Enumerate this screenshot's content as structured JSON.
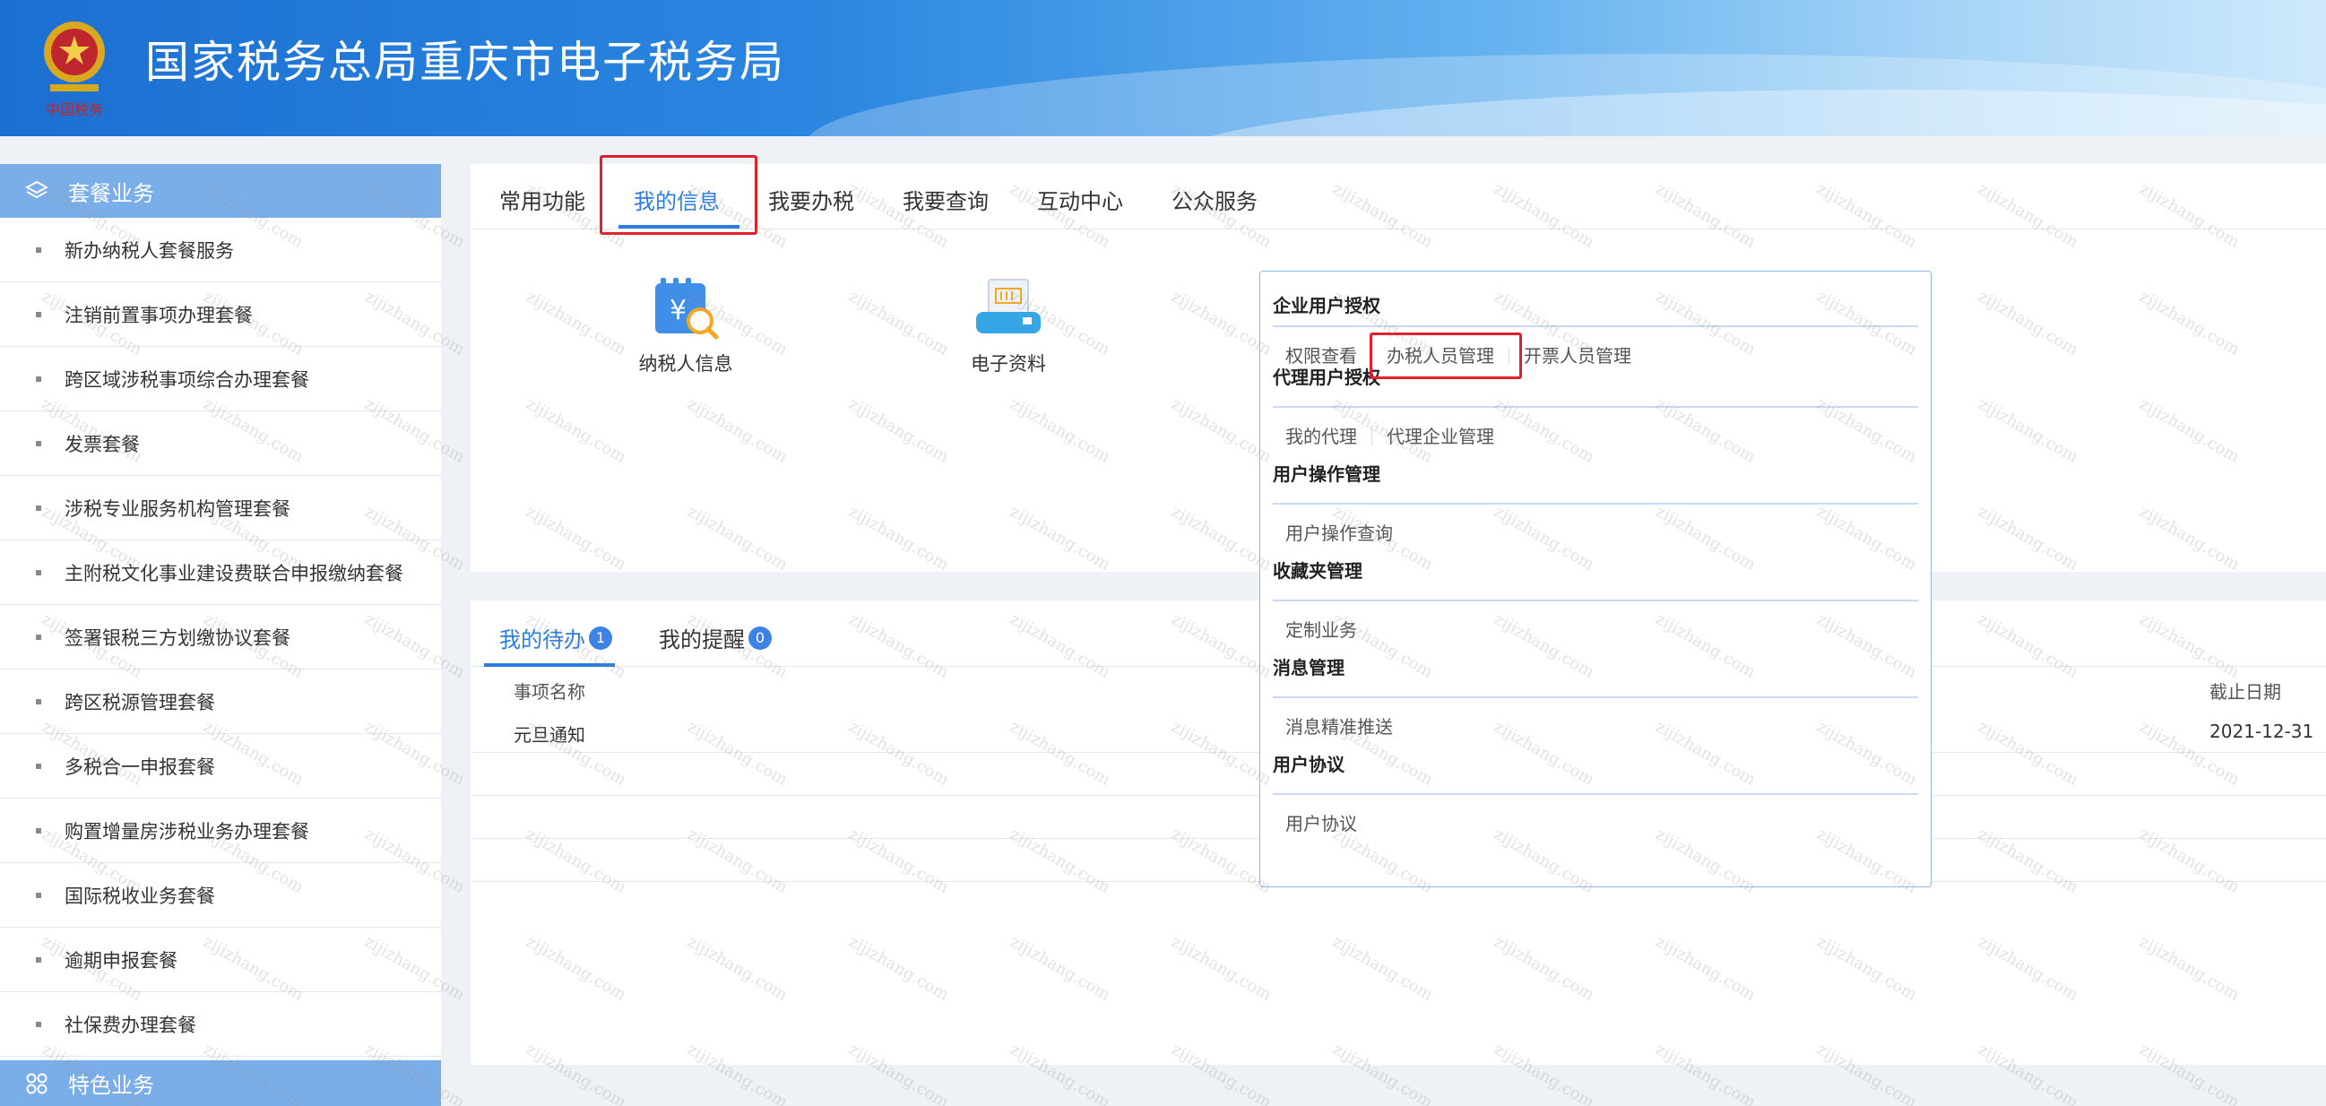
{
  "header": {
    "title": "国家税务总局重庆市电子税务局",
    "emblem_text": "中国税务"
  },
  "sidebar": {
    "section_title": "套餐业务",
    "items": [
      {
        "label": "新办纳税人套餐服务"
      },
      {
        "label": "注销前置事项办理套餐"
      },
      {
        "label": "跨区域涉税事项综合办理套餐"
      },
      {
        "label": "发票套餐"
      },
      {
        "label": "涉税专业服务机构管理套餐"
      },
      {
        "label": "主附税文化事业建设费联合申报缴纳套餐"
      },
      {
        "label": "签署银税三方划缴协议套餐"
      },
      {
        "label": "跨区税源管理套餐"
      },
      {
        "label": "多税合一申报套餐"
      },
      {
        "label": "购置增量房涉税业务办理套餐"
      },
      {
        "label": "国际税收业务套餐"
      },
      {
        "label": "逾期申报套餐"
      },
      {
        "label": "社保费办理套餐"
      }
    ],
    "footer_title": "特色业务"
  },
  "main_tabs": [
    {
      "label": "常用功能",
      "active": false
    },
    {
      "label": "我的信息",
      "active": true
    },
    {
      "label": "我要办税",
      "active": false
    },
    {
      "label": "我要查询",
      "active": false
    },
    {
      "label": "互动中心",
      "active": false
    },
    {
      "label": "公众服务",
      "active": false
    }
  ],
  "functions": [
    {
      "label": "纳税人信息",
      "icon": "taxpayer-info-icon"
    },
    {
      "label": "电子资料",
      "icon": "electronic-data-icon"
    }
  ],
  "popup": {
    "sections": [
      {
        "title": "企业用户授权",
        "items": [
          "权限查看",
          "办税人员管理",
          "开票人员管理"
        ]
      },
      {
        "title": "代理用户授权",
        "items": [
          "我的代理",
          "代理企业管理"
        ]
      },
      {
        "title": "用户操作管理",
        "items": [
          "用户操作查询"
        ]
      },
      {
        "title": "收藏夹管理",
        "items": [
          "定制业务"
        ]
      },
      {
        "title": "消息管理",
        "items": [
          "消息精准推送"
        ]
      },
      {
        "title": "用户协议",
        "items": [
          "用户协议"
        ]
      }
    ]
  },
  "bottom_tabs": [
    {
      "label": "我的待办",
      "badge": "1",
      "active": true
    },
    {
      "label": "我的提醒",
      "badge": "0",
      "active": false
    }
  ],
  "todo_table": {
    "columns": [
      "事项名称",
      "截止日期"
    ],
    "rows": [
      {
        "name": "元旦通知",
        "deadline": "2021-12-31"
      }
    ]
  },
  "watermark_text": "zijizhang.com",
  "colors": {
    "accent": "#2b7de2",
    "sidebar_head": "#7aaee8",
    "highlight_box": "#e0202a"
  }
}
